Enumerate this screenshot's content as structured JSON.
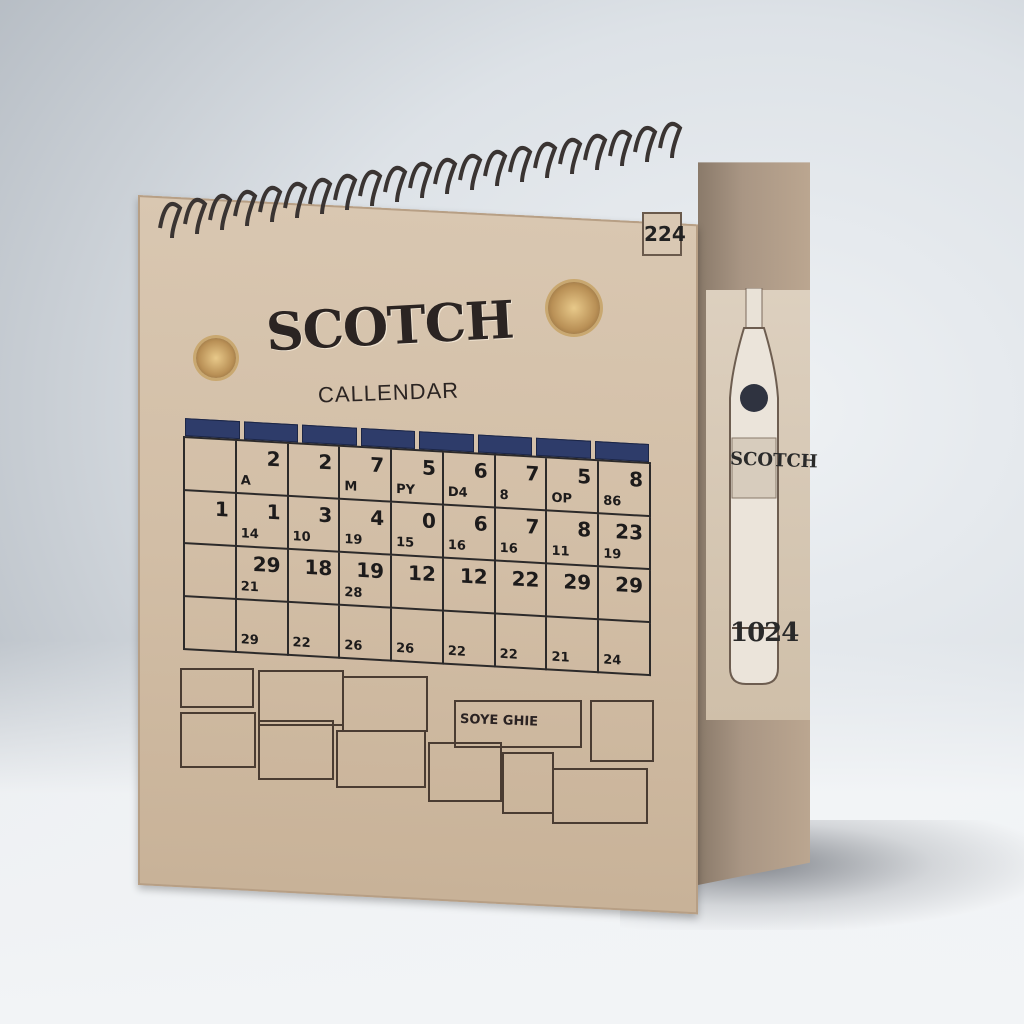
{
  "calendar": {
    "brand": "SCOTCH",
    "subtitle": "CALLENDAR",
    "year_tab": "224",
    "side_year": "1024",
    "side_brand": "SCOTCH",
    "footer_label": "SOYE GHIE"
  },
  "grid_numbers": [
    [
      "",
      "2",
      "2",
      "7",
      "5",
      "6",
      "7",
      "5",
      "8"
    ],
    [
      "1",
      "1",
      "3",
      "4",
      "0",
      "6",
      "7",
      "8",
      "23"
    ],
    [
      "",
      "29",
      "18",
      "19",
      "12",
      "12",
      "22",
      "29",
      "29"
    ],
    [
      "",
      "",
      "",
      "",
      "",
      "",
      "",
      "",
      ""
    ]
  ],
  "grid_small": [
    [
      "",
      "A",
      "",
      "M",
      "PY",
      "D4",
      "8",
      "OP",
      "86"
    ],
    [
      "",
      "14",
      "10",
      "19",
      "15",
      "16",
      "16",
      "11",
      "19"
    ],
    [
      "",
      "21",
      "",
      "28",
      "",
      "",
      "",
      "",
      ""
    ],
    [
      "",
      "29",
      "22",
      "26",
      "26",
      "22",
      "22",
      "21",
      "24"
    ]
  ],
  "colors": {
    "paper": "#d2bea6",
    "ink": "#1d1b1b",
    "header_band": "#2e3c6a",
    "seal_gold": "#c9a870"
  },
  "icons": [
    "spiral-binding",
    "gold-seal-icon",
    "bottle-illustration"
  ]
}
